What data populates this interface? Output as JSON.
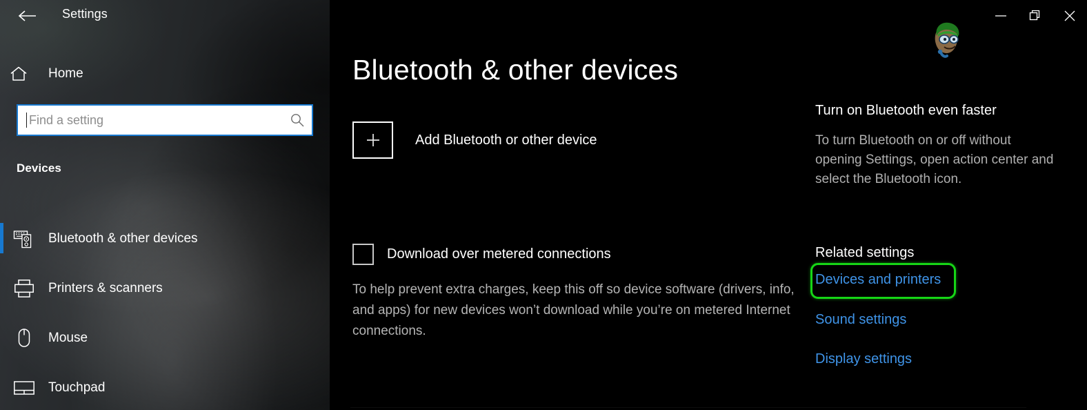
{
  "window": {
    "title": "Settings",
    "back_icon": "back-arrow-icon",
    "controls": {
      "minimize": "minimize-icon",
      "restore": "restore-icon",
      "close": "close-icon"
    }
  },
  "sidebar": {
    "home": {
      "label": "Home",
      "icon": "home-icon"
    },
    "search": {
      "value": "",
      "placeholder": "Find a setting",
      "icon": "search-icon"
    },
    "section_title": "Devices",
    "items": [
      {
        "label": "Bluetooth & other devices",
        "icon": "bluetooth-devices-icon",
        "selected": true
      },
      {
        "label": "Printers & scanners",
        "icon": "printer-icon",
        "selected": false
      },
      {
        "label": "Mouse",
        "icon": "mouse-icon",
        "selected": false
      },
      {
        "label": "Touchpad",
        "icon": "touchpad-icon",
        "selected": false
      }
    ]
  },
  "main": {
    "title": "Bluetooth & other devices",
    "add_device": {
      "label": "Add Bluetooth or other device",
      "icon": "plus-icon"
    },
    "metered": {
      "label": "Download over metered connections",
      "checked": false,
      "description": "To help prevent extra charges, keep this off so device software (drivers, info, and apps) for new devices won’t download while you’re on metered Internet connections."
    }
  },
  "rail": {
    "tip_title": "Turn on Bluetooth even faster",
    "tip_body": "To turn Bluetooth on or off without opening Settings, open action center and select the Bluetooth icon.",
    "related_title": "Related settings",
    "links": [
      {
        "label": "Devices and printers",
        "highlighted": true
      },
      {
        "label": "Sound settings",
        "highlighted": false
      },
      {
        "label": "Display settings",
        "highlighted": false
      }
    ]
  },
  "watermark": {
    "icon": "mascot-avatar-icon"
  },
  "colors": {
    "accent_blue": "#1779d0",
    "link_blue": "#3f94e8",
    "highlight_green": "#16d516",
    "content_bg": "#000000",
    "sidebar_bg": "#1f2123"
  }
}
